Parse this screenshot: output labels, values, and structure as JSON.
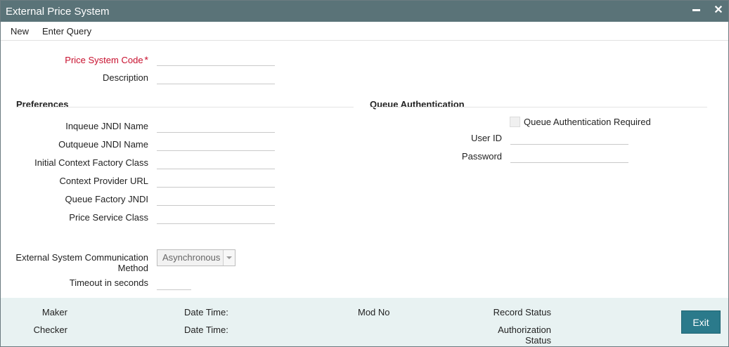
{
  "window": {
    "title": "External Price System"
  },
  "menu": {
    "new": "New",
    "enter_query": "Enter Query"
  },
  "form": {
    "price_system_code": {
      "label": "Price System Code",
      "required_mark": "*",
      "value": ""
    },
    "description": {
      "label": "Description",
      "value": ""
    }
  },
  "preferences": {
    "heading": "Preferences",
    "inqueue_jndi": {
      "label": "Inqueue JNDI Name",
      "value": ""
    },
    "outqueue_jndi": {
      "label": "Outqueue JNDI Name",
      "value": ""
    },
    "initial_context_factory": {
      "label": "Initial Context Factory Class",
      "value": ""
    },
    "context_provider_url": {
      "label": "Context Provider URL",
      "value": ""
    },
    "queue_factory_jndi": {
      "label": "Queue Factory JNDI",
      "value": ""
    },
    "price_service_class": {
      "label": "Price Service Class",
      "value": ""
    }
  },
  "queue_auth": {
    "heading": "Queue Authentication",
    "required_label": "Queue Authentication Required",
    "required_checked": false,
    "user_id": {
      "label": "User ID",
      "value": ""
    },
    "password": {
      "label": "Password",
      "value": ""
    }
  },
  "communication": {
    "method_label_line1": "External System Communication",
    "method_label_line2": "Method",
    "method_value": "Asynchronous",
    "timeout_label": "Timeout in seconds",
    "timeout_value": ""
  },
  "footer": {
    "maker": "Maker",
    "checker": "Checker",
    "date_time_1": "Date Time:",
    "date_time_2": "Date Time:",
    "mod_no": "Mod No",
    "record_status": "Record Status",
    "authorization_status_line1": "Authorization",
    "authorization_status_line2": "Status",
    "exit": "Exit"
  },
  "colors": {
    "titlebar": "#5a7378",
    "required": "#c8102e",
    "footer_bg": "#e8f2f2",
    "exit_button": "#2b7a8b"
  }
}
